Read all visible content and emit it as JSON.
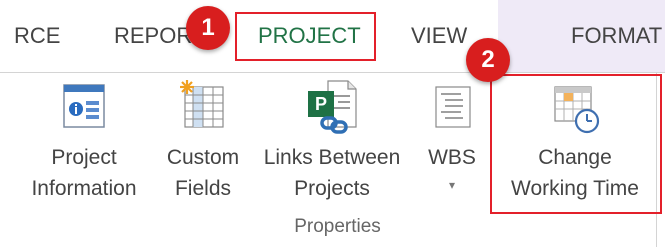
{
  "tabs": {
    "source": "RCE",
    "report": "REPOR",
    "project": "PROJECT",
    "view": "VIEW",
    "format": "FORMAT"
  },
  "badges": {
    "one": "1",
    "two": "2"
  },
  "ribbon": {
    "buttons": [
      {
        "line1": "Project",
        "line2": "Information",
        "icon": "project-information-icon"
      },
      {
        "line1": "Custom",
        "line2": "Fields",
        "icon": "custom-fields-icon"
      },
      {
        "line1": "Links Between",
        "line2": "Projects",
        "icon": "links-between-projects-icon"
      },
      {
        "line1": "WBS",
        "line2": "",
        "icon": "wbs-icon",
        "caret": "▾"
      },
      {
        "line1": "Change",
        "line2": "Working Time",
        "icon": "change-working-time-icon"
      }
    ],
    "group_label": "Properties"
  },
  "colors": {
    "annotation_red": "#e3202a",
    "badge_red": "#d81e1e",
    "active_tab_green": "#217346",
    "format_tab_bg": "#efeaf7"
  }
}
